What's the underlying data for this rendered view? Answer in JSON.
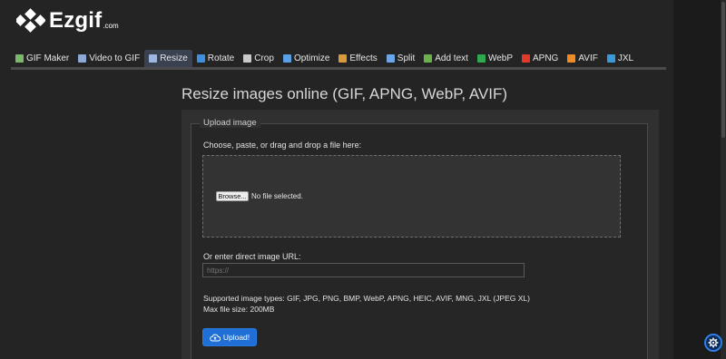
{
  "app": {
    "logo_text": "Ezgif",
    "logo_suffix": ".com"
  },
  "nav": {
    "items": [
      {
        "label": "GIF Maker",
        "icon": "gif-maker-icon",
        "color": "#7cb86a"
      },
      {
        "label": "Video to GIF",
        "icon": "video-icon",
        "color": "#8fa9d6"
      },
      {
        "label": "Resize",
        "icon": "resize-icon",
        "color": "#9fb6e0",
        "active": true
      },
      {
        "label": "Rotate",
        "icon": "rotate-icon",
        "color": "#3f8fe0"
      },
      {
        "label": "Crop",
        "icon": "crop-icon",
        "color": "#c9c9c9"
      },
      {
        "label": "Optimize",
        "icon": "optimize-icon",
        "color": "#5aa0e6"
      },
      {
        "label": "Effects",
        "icon": "effects-icon",
        "color": "#d89a3a"
      },
      {
        "label": "Split",
        "icon": "split-icon",
        "color": "#6da6e8"
      },
      {
        "label": "Add text",
        "icon": "add-text-icon",
        "color": "#6ab04c"
      },
      {
        "label": "WebP",
        "icon": "webp-icon",
        "color": "#2fa84f"
      },
      {
        "label": "APNG",
        "icon": "apng-icon",
        "color": "#e23a2a"
      },
      {
        "label": "AVIF",
        "icon": "avif-icon",
        "color": "#f08a24"
      },
      {
        "label": "JXL",
        "icon": "jxl-icon",
        "color": "#3a9ad9"
      }
    ]
  },
  "main": {
    "title": "Resize images online (GIF, APNG, WebP, AVIF)",
    "legend": "Upload image",
    "choose_label": "Choose, paste, or drag and drop a file here:",
    "browse_label": "Browse...",
    "no_file_text": "No file selected.",
    "url_label": "Or enter direct image URL:",
    "url_placeholder": "https://",
    "url_value": "",
    "supported_types": "Supported image types: GIF, JPG, PNG, BMP, WebP, APNG, HEIC, AVIF, MNG, JXL (JPEG XL)",
    "max_size": "Max file size: 200MB",
    "upload_label": "Upload!",
    "upload_icon": "cloud-upload-icon"
  },
  "floating": {
    "settings_icon": "gear-icon"
  },
  "colors": {
    "accent": "#1f6fd6",
    "background": "#242424",
    "panel": "#303030",
    "nav_active": "#3a4150"
  }
}
